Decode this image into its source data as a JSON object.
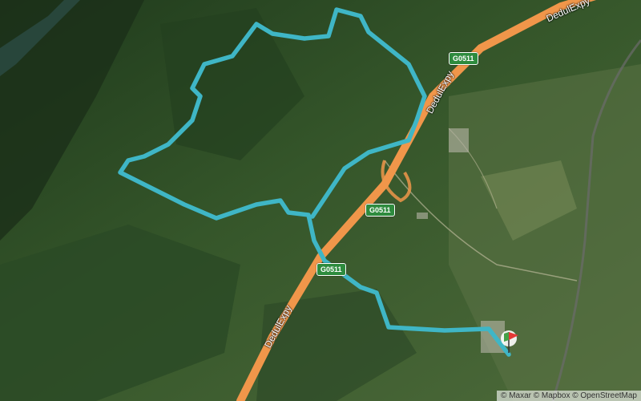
{
  "map": {
    "road_name": "DedulExpy",
    "road_name_2": "DedulExpy",
    "highway_shield": "G0511",
    "attribution": "© Maxar © Mapbox © OpenStreetMap",
    "route_color": "#3fb6c6",
    "road_color": "#f0964a"
  }
}
